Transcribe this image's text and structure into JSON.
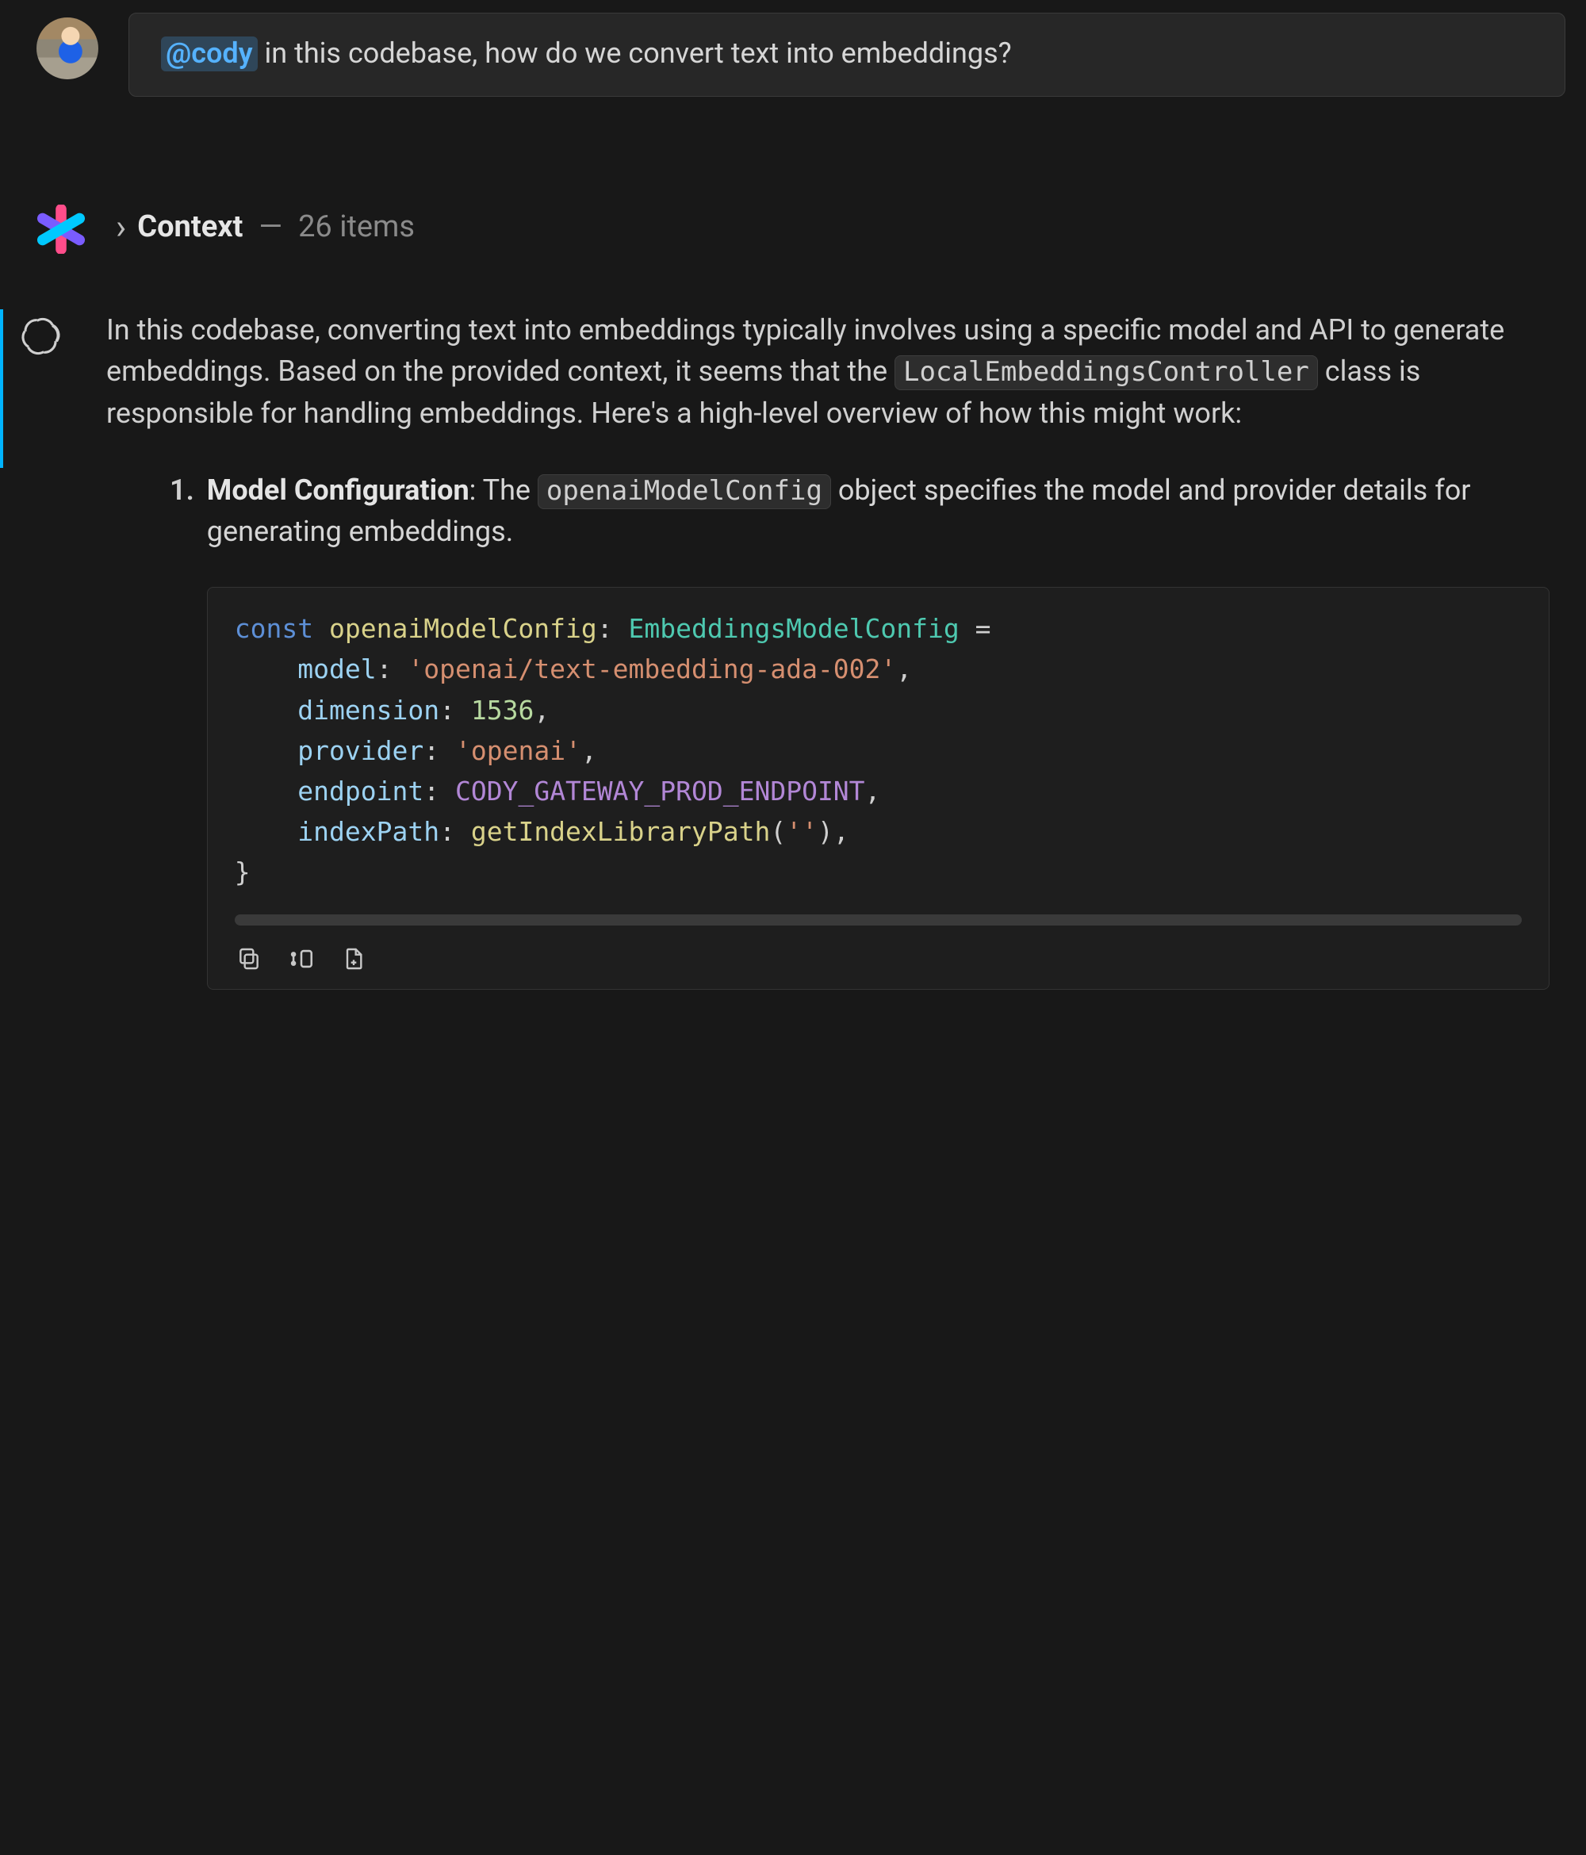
{
  "user_message": {
    "mention": "@cody",
    "text_after_mention": " in this codebase, how do we convert text into embeddings?"
  },
  "context": {
    "label": "Context",
    "count_text": "26 items"
  },
  "answer": {
    "paragraph_before_code1": "In this codebase, converting text into embeddings typically involves using a specific model and API to generate embeddings. Based on the provided context, it seems that the ",
    "inline_code1": "LocalEmbeddingsController",
    "paragraph_after_code1": " class is responsible for handling embeddings. Here's a high-level overview of how this might work:",
    "list_item1": {
      "number": "1.",
      "title": "Model Configuration",
      "text_before_code": ": The ",
      "inline_code": "openaiModelConfig",
      "text_after_code": " object specifies the model and provider details for generating embeddings."
    }
  },
  "code": {
    "l1_kw": "const",
    "l1_name": " openaiModelConfig",
    "l1_rest1": ": ",
    "l1_type": "EmbeddingsModelConfig",
    "l1_rest2": " = ",
    "l2_prop": "model",
    "l2_sep": ": ",
    "l2_val": "'openai/text-embedding-ada-002'",
    "l2_end": ",",
    "l3_prop": "dimension",
    "l3_sep": ": ",
    "l3_val": "1536",
    "l3_end": ",",
    "l4_prop": "provider",
    "l4_sep": ": ",
    "l4_val": "'openai'",
    "l4_end": ",",
    "l5_prop": "endpoint",
    "l5_sep": ": ",
    "l5_val": "CODY_GATEWAY_PROD_ENDPOINT",
    "l5_end": ",",
    "l6_prop": "indexPath",
    "l6_sep": ": ",
    "l6_fn": "getIndexLibraryPath",
    "l6_open": "(",
    "l6_arg": "''",
    "l6_close": "),",
    "close": "}"
  },
  "tools": {
    "copy": "copy-icon",
    "insert": "insert-icon",
    "newfile": "new-file-icon"
  }
}
